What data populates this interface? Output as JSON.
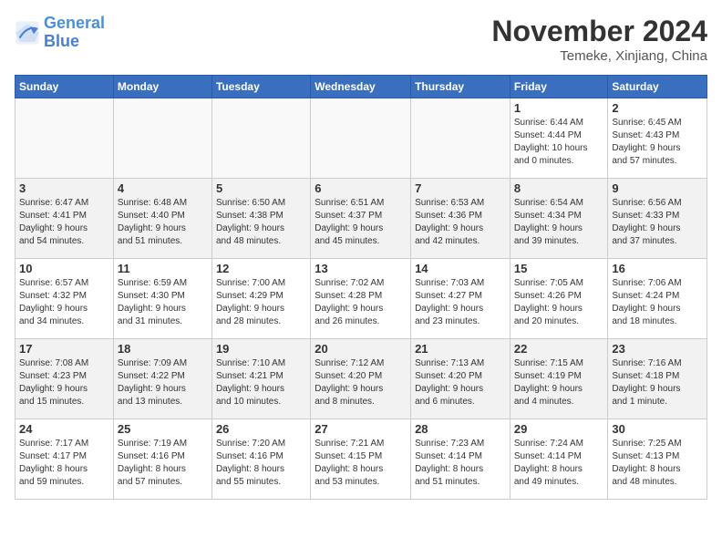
{
  "logo": {
    "line1": "General",
    "line2": "Blue"
  },
  "title": "November 2024",
  "location": "Temeke, Xinjiang, China",
  "weekdays": [
    "Sunday",
    "Monday",
    "Tuesday",
    "Wednesday",
    "Thursday",
    "Friday",
    "Saturday"
  ],
  "weeks": [
    [
      {
        "day": "",
        "info": ""
      },
      {
        "day": "",
        "info": ""
      },
      {
        "day": "",
        "info": ""
      },
      {
        "day": "",
        "info": ""
      },
      {
        "day": "",
        "info": ""
      },
      {
        "day": "1",
        "info": "Sunrise: 6:44 AM\nSunset: 4:44 PM\nDaylight: 10 hours\nand 0 minutes."
      },
      {
        "day": "2",
        "info": "Sunrise: 6:45 AM\nSunset: 4:43 PM\nDaylight: 9 hours\nand 57 minutes."
      }
    ],
    [
      {
        "day": "3",
        "info": "Sunrise: 6:47 AM\nSunset: 4:41 PM\nDaylight: 9 hours\nand 54 minutes."
      },
      {
        "day": "4",
        "info": "Sunrise: 6:48 AM\nSunset: 4:40 PM\nDaylight: 9 hours\nand 51 minutes."
      },
      {
        "day": "5",
        "info": "Sunrise: 6:50 AM\nSunset: 4:38 PM\nDaylight: 9 hours\nand 48 minutes."
      },
      {
        "day": "6",
        "info": "Sunrise: 6:51 AM\nSunset: 4:37 PM\nDaylight: 9 hours\nand 45 minutes."
      },
      {
        "day": "7",
        "info": "Sunrise: 6:53 AM\nSunset: 4:36 PM\nDaylight: 9 hours\nand 42 minutes."
      },
      {
        "day": "8",
        "info": "Sunrise: 6:54 AM\nSunset: 4:34 PM\nDaylight: 9 hours\nand 39 minutes."
      },
      {
        "day": "9",
        "info": "Sunrise: 6:56 AM\nSunset: 4:33 PM\nDaylight: 9 hours\nand 37 minutes."
      }
    ],
    [
      {
        "day": "10",
        "info": "Sunrise: 6:57 AM\nSunset: 4:32 PM\nDaylight: 9 hours\nand 34 minutes."
      },
      {
        "day": "11",
        "info": "Sunrise: 6:59 AM\nSunset: 4:30 PM\nDaylight: 9 hours\nand 31 minutes."
      },
      {
        "day": "12",
        "info": "Sunrise: 7:00 AM\nSunset: 4:29 PM\nDaylight: 9 hours\nand 28 minutes."
      },
      {
        "day": "13",
        "info": "Sunrise: 7:02 AM\nSunset: 4:28 PM\nDaylight: 9 hours\nand 26 minutes."
      },
      {
        "day": "14",
        "info": "Sunrise: 7:03 AM\nSunset: 4:27 PM\nDaylight: 9 hours\nand 23 minutes."
      },
      {
        "day": "15",
        "info": "Sunrise: 7:05 AM\nSunset: 4:26 PM\nDaylight: 9 hours\nand 20 minutes."
      },
      {
        "day": "16",
        "info": "Sunrise: 7:06 AM\nSunset: 4:24 PM\nDaylight: 9 hours\nand 18 minutes."
      }
    ],
    [
      {
        "day": "17",
        "info": "Sunrise: 7:08 AM\nSunset: 4:23 PM\nDaylight: 9 hours\nand 15 minutes."
      },
      {
        "day": "18",
        "info": "Sunrise: 7:09 AM\nSunset: 4:22 PM\nDaylight: 9 hours\nand 13 minutes."
      },
      {
        "day": "19",
        "info": "Sunrise: 7:10 AM\nSunset: 4:21 PM\nDaylight: 9 hours\nand 10 minutes."
      },
      {
        "day": "20",
        "info": "Sunrise: 7:12 AM\nSunset: 4:20 PM\nDaylight: 9 hours\nand 8 minutes."
      },
      {
        "day": "21",
        "info": "Sunrise: 7:13 AM\nSunset: 4:20 PM\nDaylight: 9 hours\nand 6 minutes."
      },
      {
        "day": "22",
        "info": "Sunrise: 7:15 AM\nSunset: 4:19 PM\nDaylight: 9 hours\nand 4 minutes."
      },
      {
        "day": "23",
        "info": "Sunrise: 7:16 AM\nSunset: 4:18 PM\nDaylight: 9 hours\nand 1 minute."
      }
    ],
    [
      {
        "day": "24",
        "info": "Sunrise: 7:17 AM\nSunset: 4:17 PM\nDaylight: 8 hours\nand 59 minutes."
      },
      {
        "day": "25",
        "info": "Sunrise: 7:19 AM\nSunset: 4:16 PM\nDaylight: 8 hours\nand 57 minutes."
      },
      {
        "day": "26",
        "info": "Sunrise: 7:20 AM\nSunset: 4:16 PM\nDaylight: 8 hours\nand 55 minutes."
      },
      {
        "day": "27",
        "info": "Sunrise: 7:21 AM\nSunset: 4:15 PM\nDaylight: 8 hours\nand 53 minutes."
      },
      {
        "day": "28",
        "info": "Sunrise: 7:23 AM\nSunset: 4:14 PM\nDaylight: 8 hours\nand 51 minutes."
      },
      {
        "day": "29",
        "info": "Sunrise: 7:24 AM\nSunset: 4:14 PM\nDaylight: 8 hours\nand 49 minutes."
      },
      {
        "day": "30",
        "info": "Sunrise: 7:25 AM\nSunset: 4:13 PM\nDaylight: 8 hours\nand 48 minutes."
      }
    ]
  ]
}
